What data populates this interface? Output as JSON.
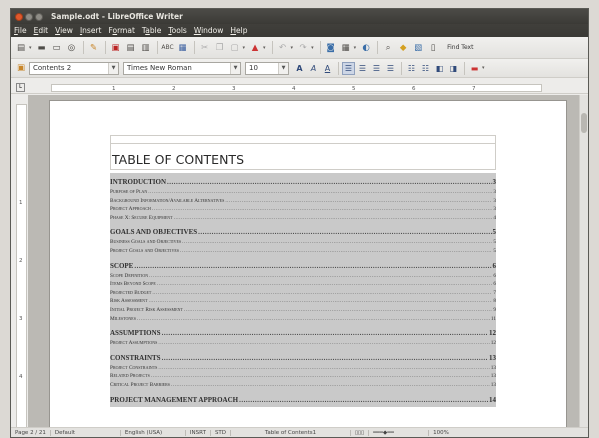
{
  "window": {
    "title": "Sample.odt - LibreOffice Writer"
  },
  "menu": {
    "items": [
      {
        "label": "File",
        "mnemonic": "F",
        "rest": "ile"
      },
      {
        "label": "Edit",
        "mnemonic": "E",
        "rest": "dit"
      },
      {
        "label": "View",
        "mnemonic": "V",
        "rest": "iew"
      },
      {
        "label": "Insert",
        "mnemonic": "I",
        "rest": "nsert"
      },
      {
        "label": "Format",
        "mnemonic": "o",
        "pre": "F",
        "rest": "rmat"
      },
      {
        "label": "Table",
        "mnemonic": "a",
        "pre": "T",
        "rest": "ble"
      },
      {
        "label": "Tools",
        "mnemonic": "T",
        "rest": "ools"
      },
      {
        "label": "Window",
        "mnemonic": "W",
        "rest": "indow"
      },
      {
        "label": "Help",
        "mnemonic": "H",
        "rest": "elp"
      }
    ]
  },
  "toolbar": {
    "find_text": "Find Text"
  },
  "formatting": {
    "paragraph_style": "Contents 2",
    "font_name": "Times New Roman",
    "font_size": "10"
  },
  "ruler": {
    "numbers": [
      "1",
      "2",
      "3",
      "4",
      "5",
      "6",
      "7"
    ]
  },
  "vruler": {
    "numbers": [
      "1",
      "2",
      "3",
      "4"
    ]
  },
  "document": {
    "toc_title": "TABLE OF CONTENTS",
    "entries": [
      {
        "title": "INTRODUCTION",
        "page": "3",
        "level": 1
      },
      {
        "title": "Purpose of Plan",
        "page": "3",
        "level": 2
      },
      {
        "title": "Background Information/Available Alternatives",
        "page": "3",
        "level": 2
      },
      {
        "title": "Project Approach",
        "page": "3",
        "level": 2
      },
      {
        "title": "Phase X: Secure Equipment",
        "page": "4",
        "level": 2
      },
      {
        "title": "GOALS AND OBJECTIVES",
        "page": "5",
        "level": 1
      },
      {
        "title": "Business Goals and Objectives",
        "page": "5",
        "level": 2
      },
      {
        "title": "Project Goals and Objectives",
        "page": "5",
        "level": 2
      },
      {
        "title": "SCOPE",
        "page": "6",
        "level": 1
      },
      {
        "title": "Scope Definition",
        "page": "6",
        "level": 2
      },
      {
        "title": "Items Beyond Scope",
        "page": "6",
        "level": 2
      },
      {
        "title": "Projected Budget",
        "page": "7",
        "level": 2
      },
      {
        "title": "Risk Assessment",
        "page": "8",
        "level": 2
      },
      {
        "title": "Initial Project Risk Assessment",
        "page": "9",
        "level": 2
      },
      {
        "title": "Milestones",
        "page": "11",
        "level": 2
      },
      {
        "title": "ASSUMPTIONS",
        "page": "12",
        "level": 1
      },
      {
        "title": "Project Assumptions",
        "page": "12",
        "level": 2
      },
      {
        "title": "CONSTRAINTS",
        "page": "13",
        "level": 1
      },
      {
        "title": "Project Constraints",
        "page": "13",
        "level": 2
      },
      {
        "title": "Related Projects",
        "page": "13",
        "level": 2
      },
      {
        "title": "Critical Project Barriers",
        "page": "13",
        "level": 2
      },
      {
        "title": "PROJECT MANAGEMENT APPROACH",
        "page": "14",
        "level": 1
      }
    ]
  },
  "status": {
    "page": "Page 2 / 21",
    "style": "Default",
    "language": "English (USA)",
    "insert_mode": "INSRT",
    "selection_mode": "STD",
    "section": "Table of Contents1",
    "zoom": "100%"
  },
  "colors": {
    "accent": "#e0582c",
    "toc_shade": "#c9c9c9"
  }
}
